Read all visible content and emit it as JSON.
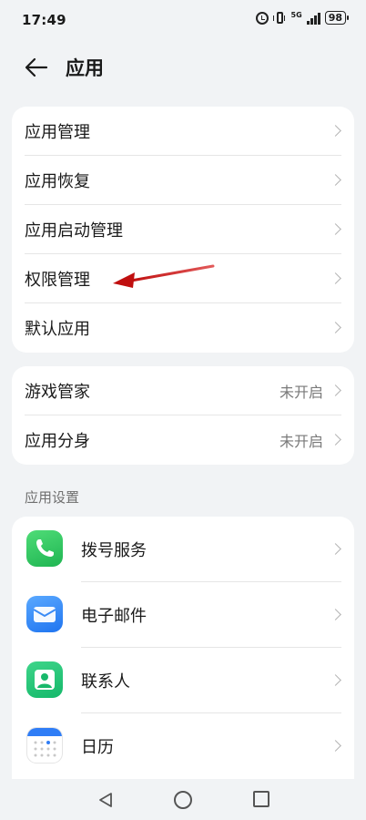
{
  "status_bar": {
    "time": "17:49",
    "network": "5G",
    "battery": "98"
  },
  "header": {
    "title": "应用"
  },
  "group1": {
    "items": [
      {
        "label": "应用管理"
      },
      {
        "label": "应用恢复"
      },
      {
        "label": "应用启动管理"
      },
      {
        "label": "权限管理"
      },
      {
        "label": "默认应用"
      }
    ]
  },
  "group2": {
    "items": [
      {
        "label": "游戏管家",
        "value": "未开启"
      },
      {
        "label": "应用分身",
        "value": "未开启"
      }
    ]
  },
  "app_settings": {
    "section_title": "应用设置",
    "items": [
      {
        "label": "拨号服务",
        "icon": "phone-icon"
      },
      {
        "label": "电子邮件",
        "icon": "mail-icon"
      },
      {
        "label": "联系人",
        "icon": "contact-icon"
      },
      {
        "label": "日历",
        "icon": "calendar-icon"
      }
    ]
  },
  "annotation": {
    "color": "#d11a1a"
  },
  "colors": {
    "background": "#f1f3f5",
    "card": "#ffffff",
    "secondary_text": "#7a7a7a"
  }
}
